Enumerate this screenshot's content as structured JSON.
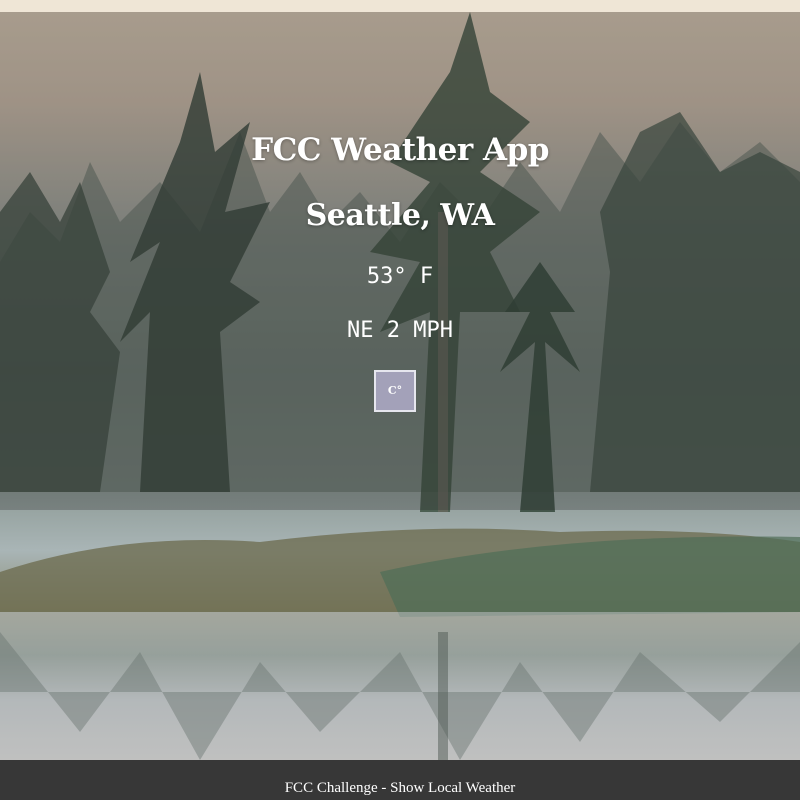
{
  "header": {
    "title": "FCC Weather App"
  },
  "weather": {
    "location": "Seattle, WA",
    "temperature": "53° F",
    "wind": "NE 2 MPH"
  },
  "controls": {
    "unit_toggle_label": "C°"
  },
  "footer": {
    "text": "FCC Challenge - Show Local Weather"
  },
  "background": {
    "description_icon": "foggy-lake-forest-image",
    "overlay_color": "#282828",
    "footer_color": "#373737",
    "button_color": "#a3a1b9"
  }
}
